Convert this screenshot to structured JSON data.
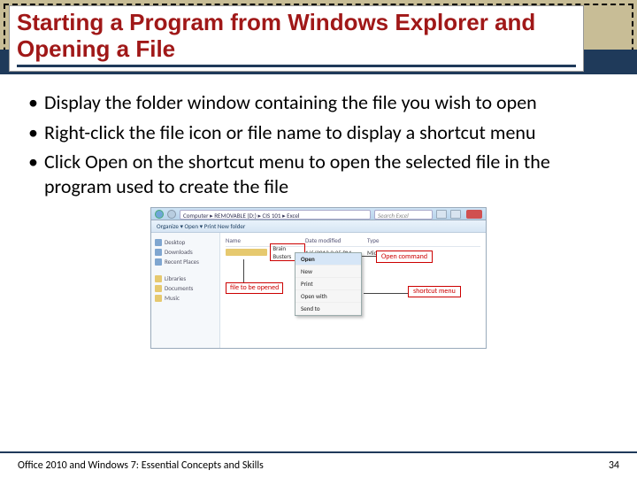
{
  "title": "Starting a Program from Windows Explorer and Opening a File",
  "bullets": [
    "Display the folder window containing the file you wish to open",
    "Right-click the file icon or file name to display a shortcut menu",
    "Click Open on the shortcut menu to open the selected file in the program used to create the file"
  ],
  "screenshot": {
    "path": "Computer ▸ REMOVABLE (D:) ▸ CIS 101 ▸ Excel",
    "search_placeholder": "Search Excel",
    "toolbar": "Organize ▾   Open ▾   Print   New folder",
    "side_items": [
      "Desktop",
      "Downloads",
      "Recent Places",
      "",
      "Libraries",
      "Documents",
      "Music"
    ],
    "col_name": "Name",
    "col_date": "Date modified",
    "col_type": "Type",
    "file_name": "Brain Busters",
    "file_date": "1/6/2012 3:35 PM",
    "file_type": "Microsoft Excel W...",
    "menu": [
      "Open",
      "New",
      "Print",
      "",
      "Open with",
      "",
      "Send to"
    ]
  },
  "callouts": {
    "open_cmd": "Open command",
    "shortcut_menu": "shortcut\nmenu",
    "file_to_open": "file to be\nopened"
  },
  "footer_left": "Office 2010 and Windows 7: Essential Concepts and Skills",
  "footer_right": "34"
}
